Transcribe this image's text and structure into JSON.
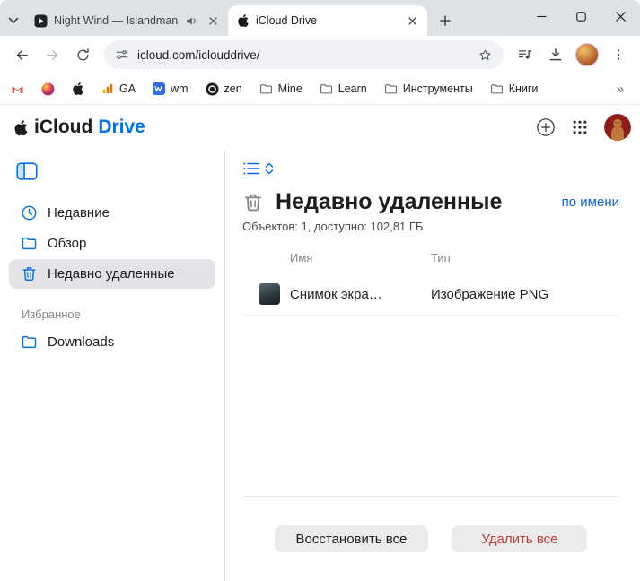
{
  "colors": {
    "accent_blue": "#0071e3",
    "link_blue": "#0b63ce",
    "danger_red": "#c23a31",
    "selected_gray": "#e3e3e8",
    "tabstrip_gray": "#dee1e6"
  },
  "browser": {
    "tabs": [
      {
        "title": "Night Wind — Islandman"
      },
      {
        "title": "iCloud Drive"
      }
    ],
    "url": "icloud.com/iclouddrive/"
  },
  "bookmarks": {
    "items": [
      {
        "label": "GA"
      },
      {
        "label": "wm"
      },
      {
        "label": "zen"
      },
      {
        "label": "Mine"
      },
      {
        "label": "Learn"
      },
      {
        "label": "Инструменты"
      },
      {
        "label": "Книги"
      }
    ],
    "overflow": "»"
  },
  "icloud": {
    "brand": {
      "name": "iCloud",
      "app": "Drive"
    },
    "sidebar": {
      "items": [
        {
          "label": "Недавние"
        },
        {
          "label": "Обзор"
        },
        {
          "label": "Недавно удаленные"
        }
      ],
      "section": "Избранное",
      "favorites": [
        {
          "label": "Downloads"
        }
      ]
    },
    "content": {
      "title": "Недавно удаленные",
      "sort": "по имени",
      "summary": "Объектов: 1, доступно: 102,81 ГБ",
      "columns": {
        "name": "Имя",
        "type": "Тип"
      },
      "rows": [
        {
          "name": "Снимок экра…",
          "type": "Изображение PNG"
        }
      ],
      "actions": {
        "restore": "Восстановить все",
        "delete": "Удалить все"
      }
    }
  }
}
